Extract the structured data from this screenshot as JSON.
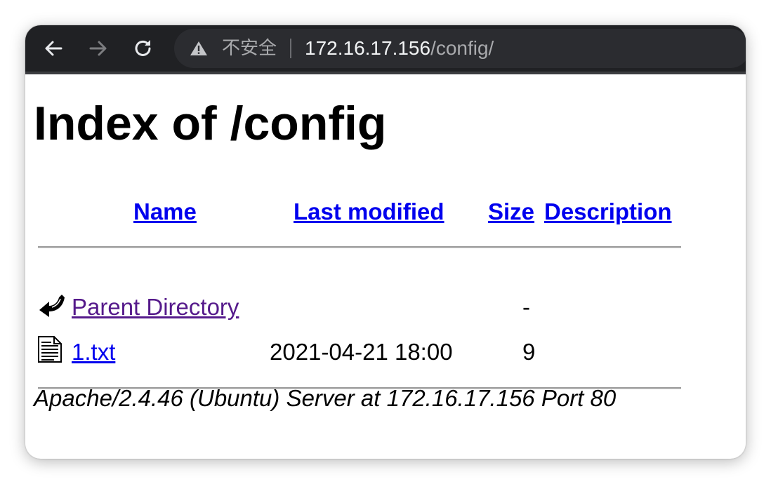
{
  "browser": {
    "security_label": "不安全",
    "url_host": "172.16.17.156",
    "url_path": "/config/"
  },
  "page": {
    "title": "Index of /config",
    "columns": [
      "Name",
      "Last modified",
      "Size",
      "Description"
    ],
    "rows": [
      {
        "icon": "back-arrow-icon",
        "name": "Parent Directory",
        "modified": "",
        "size": "-",
        "description": "",
        "visited": true
      },
      {
        "icon": "text-file-icon",
        "name": "1.txt",
        "modified": "2021-04-21 18:00",
        "size": "9",
        "description": "",
        "visited": false
      }
    ],
    "footer": "Apache/2.4.46 (Ubuntu) Server at 172.16.17.156 Port 80"
  },
  "colors": {
    "link": "#0000ee",
    "visited_link": "#551a8b",
    "toolbar_bg": "#202124"
  }
}
